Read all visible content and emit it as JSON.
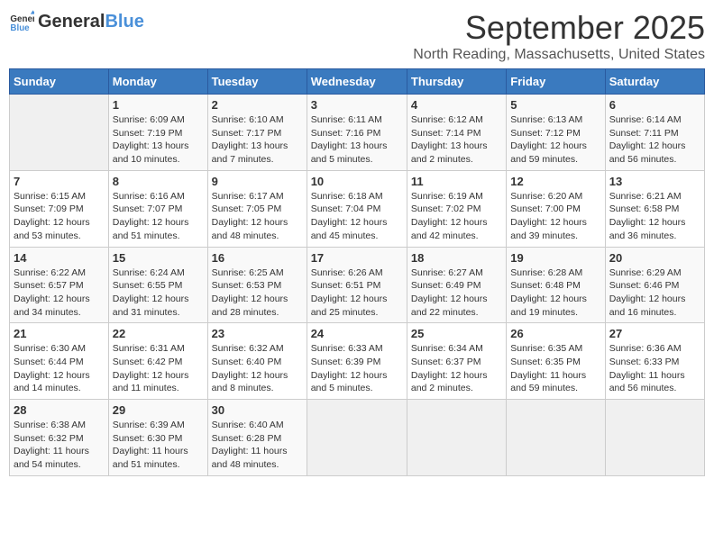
{
  "header": {
    "logo_general": "General",
    "logo_blue": "Blue",
    "month": "September 2025",
    "location": "North Reading, Massachusetts, United States"
  },
  "weekdays": [
    "Sunday",
    "Monday",
    "Tuesday",
    "Wednesday",
    "Thursday",
    "Friday",
    "Saturday"
  ],
  "weeks": [
    [
      {
        "day": "",
        "info": ""
      },
      {
        "day": "1",
        "info": "Sunrise: 6:09 AM\nSunset: 7:19 PM\nDaylight: 13 hours\nand 10 minutes."
      },
      {
        "day": "2",
        "info": "Sunrise: 6:10 AM\nSunset: 7:17 PM\nDaylight: 13 hours\nand 7 minutes."
      },
      {
        "day": "3",
        "info": "Sunrise: 6:11 AM\nSunset: 7:16 PM\nDaylight: 13 hours\nand 5 minutes."
      },
      {
        "day": "4",
        "info": "Sunrise: 6:12 AM\nSunset: 7:14 PM\nDaylight: 13 hours\nand 2 minutes."
      },
      {
        "day": "5",
        "info": "Sunrise: 6:13 AM\nSunset: 7:12 PM\nDaylight: 12 hours\nand 59 minutes."
      },
      {
        "day": "6",
        "info": "Sunrise: 6:14 AM\nSunset: 7:11 PM\nDaylight: 12 hours\nand 56 minutes."
      }
    ],
    [
      {
        "day": "7",
        "info": "Sunrise: 6:15 AM\nSunset: 7:09 PM\nDaylight: 12 hours\nand 53 minutes."
      },
      {
        "day": "8",
        "info": "Sunrise: 6:16 AM\nSunset: 7:07 PM\nDaylight: 12 hours\nand 51 minutes."
      },
      {
        "day": "9",
        "info": "Sunrise: 6:17 AM\nSunset: 7:05 PM\nDaylight: 12 hours\nand 48 minutes."
      },
      {
        "day": "10",
        "info": "Sunrise: 6:18 AM\nSunset: 7:04 PM\nDaylight: 12 hours\nand 45 minutes."
      },
      {
        "day": "11",
        "info": "Sunrise: 6:19 AM\nSunset: 7:02 PM\nDaylight: 12 hours\nand 42 minutes."
      },
      {
        "day": "12",
        "info": "Sunrise: 6:20 AM\nSunset: 7:00 PM\nDaylight: 12 hours\nand 39 minutes."
      },
      {
        "day": "13",
        "info": "Sunrise: 6:21 AM\nSunset: 6:58 PM\nDaylight: 12 hours\nand 36 minutes."
      }
    ],
    [
      {
        "day": "14",
        "info": "Sunrise: 6:22 AM\nSunset: 6:57 PM\nDaylight: 12 hours\nand 34 minutes."
      },
      {
        "day": "15",
        "info": "Sunrise: 6:24 AM\nSunset: 6:55 PM\nDaylight: 12 hours\nand 31 minutes."
      },
      {
        "day": "16",
        "info": "Sunrise: 6:25 AM\nSunset: 6:53 PM\nDaylight: 12 hours\nand 28 minutes."
      },
      {
        "day": "17",
        "info": "Sunrise: 6:26 AM\nSunset: 6:51 PM\nDaylight: 12 hours\nand 25 minutes."
      },
      {
        "day": "18",
        "info": "Sunrise: 6:27 AM\nSunset: 6:49 PM\nDaylight: 12 hours\nand 22 minutes."
      },
      {
        "day": "19",
        "info": "Sunrise: 6:28 AM\nSunset: 6:48 PM\nDaylight: 12 hours\nand 19 minutes."
      },
      {
        "day": "20",
        "info": "Sunrise: 6:29 AM\nSunset: 6:46 PM\nDaylight: 12 hours\nand 16 minutes."
      }
    ],
    [
      {
        "day": "21",
        "info": "Sunrise: 6:30 AM\nSunset: 6:44 PM\nDaylight: 12 hours\nand 14 minutes."
      },
      {
        "day": "22",
        "info": "Sunrise: 6:31 AM\nSunset: 6:42 PM\nDaylight: 12 hours\nand 11 minutes."
      },
      {
        "day": "23",
        "info": "Sunrise: 6:32 AM\nSunset: 6:40 PM\nDaylight: 12 hours\nand 8 minutes."
      },
      {
        "day": "24",
        "info": "Sunrise: 6:33 AM\nSunset: 6:39 PM\nDaylight: 12 hours\nand 5 minutes."
      },
      {
        "day": "25",
        "info": "Sunrise: 6:34 AM\nSunset: 6:37 PM\nDaylight: 12 hours\nand 2 minutes."
      },
      {
        "day": "26",
        "info": "Sunrise: 6:35 AM\nSunset: 6:35 PM\nDaylight: 11 hours\nand 59 minutes."
      },
      {
        "day": "27",
        "info": "Sunrise: 6:36 AM\nSunset: 6:33 PM\nDaylight: 11 hours\nand 56 minutes."
      }
    ],
    [
      {
        "day": "28",
        "info": "Sunrise: 6:38 AM\nSunset: 6:32 PM\nDaylight: 11 hours\nand 54 minutes."
      },
      {
        "day": "29",
        "info": "Sunrise: 6:39 AM\nSunset: 6:30 PM\nDaylight: 11 hours\nand 51 minutes."
      },
      {
        "day": "30",
        "info": "Sunrise: 6:40 AM\nSunset: 6:28 PM\nDaylight: 11 hours\nand 48 minutes."
      },
      {
        "day": "",
        "info": ""
      },
      {
        "day": "",
        "info": ""
      },
      {
        "day": "",
        "info": ""
      },
      {
        "day": "",
        "info": ""
      }
    ]
  ]
}
